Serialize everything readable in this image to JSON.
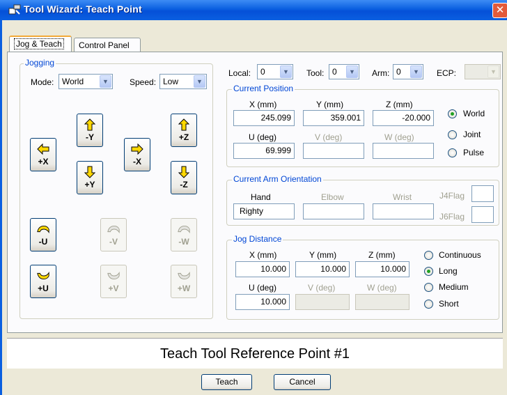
{
  "window": {
    "title": "Tool Wizard: Teach Point",
    "close": "✕"
  },
  "tabs": [
    {
      "label": "Jog & Teach",
      "active": true
    },
    {
      "label": "Control Panel",
      "active": false
    }
  ],
  "jogging": {
    "legend": "Jogging",
    "mode_label": "Mode:",
    "mode_value": "World",
    "speed_label": "Speed:",
    "speed_value": "Low",
    "buttons": [
      {
        "label": "+X",
        "icon": "arrow-left-icon",
        "enabled": true
      },
      {
        "label": "-Y",
        "icon": "arrow-up-icon",
        "enabled": true
      },
      {
        "label": "+Y",
        "icon": "arrow-down-icon",
        "enabled": true
      },
      {
        "label": "-X",
        "icon": "arrow-right-icon",
        "enabled": true
      },
      {
        "label": "+Z",
        "icon": "arrow-up-icon",
        "enabled": true
      },
      {
        "label": "-Z",
        "icon": "arrow-down-icon",
        "enabled": true
      },
      {
        "label": "-U",
        "icon": "rotate-ccw-icon",
        "enabled": true
      },
      {
        "label": "-V",
        "icon": "rotate-ccw-icon",
        "enabled": false
      },
      {
        "label": "-W",
        "icon": "rotate-ccw-icon",
        "enabled": false
      },
      {
        "label": "+U",
        "icon": "rotate-cw-icon",
        "enabled": true
      },
      {
        "label": "+V",
        "icon": "rotate-cw-icon",
        "enabled": false
      },
      {
        "label": "+W",
        "icon": "rotate-cw-icon",
        "enabled": false
      }
    ]
  },
  "selectors": {
    "local_label": "Local:",
    "local_value": "0",
    "tool_label": "Tool:",
    "tool_value": "0",
    "arm_label": "Arm:",
    "arm_value": "0",
    "ecp_label": "ECP:",
    "ecp_value": ""
  },
  "current_position": {
    "legend": "Current Position",
    "x_label": "X (mm)",
    "x": "245.099",
    "y_label": "Y (mm)",
    "y": "359.001",
    "z_label": "Z (mm)",
    "z": "-20.000",
    "u_label": "U (deg)",
    "u": "69.999",
    "v_label": "V (deg)",
    "v": "",
    "w_label": "W (deg)",
    "w": "",
    "modes": [
      {
        "label": "World",
        "checked": true
      },
      {
        "label": "Joint",
        "checked": false
      },
      {
        "label": "Pulse",
        "checked": false
      }
    ]
  },
  "orientation": {
    "legend": "Current Arm Orientation",
    "hand_label": "Hand",
    "hand": "Righty",
    "elbow_label": "Elbow",
    "elbow": "",
    "wrist_label": "Wrist",
    "wrist": "",
    "j4_label": "J4Flag",
    "j6_label": "J6Flag"
  },
  "jog_distance": {
    "legend": "Jog Distance",
    "x_label": "X (mm)",
    "x": "10.000",
    "y_label": "Y (mm)",
    "y": "10.000",
    "z_label": "Z (mm)",
    "z": "10.000",
    "u_label": "U (deg)",
    "u": "10.000",
    "v_label": "V (deg)",
    "w_label": "W (deg)",
    "modes": [
      {
        "label": "Continuous",
        "checked": false
      },
      {
        "label": "Long",
        "checked": true
      },
      {
        "label": "Medium",
        "checked": false
      },
      {
        "label": "Short",
        "checked": false
      }
    ]
  },
  "banner": "Teach Tool Reference Point #1",
  "buttons": {
    "teach": "Teach",
    "cancel": "Cancel"
  },
  "colors": {
    "titlebar": "#0a5fe0",
    "legend": "#0046d5",
    "arrow_yellow": "#ffd800"
  }
}
